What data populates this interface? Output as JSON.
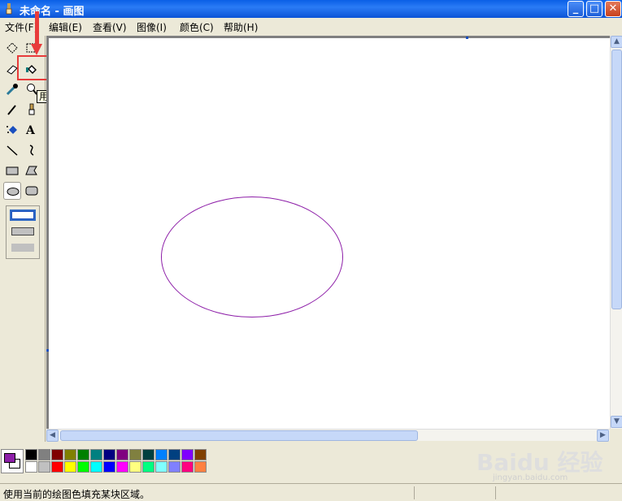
{
  "window": {
    "title": "未命名 - 画图"
  },
  "menu": [
    {
      "label": "文件(F)"
    },
    {
      "label": "编辑(E)"
    },
    {
      "label": "查看(V)"
    },
    {
      "label": "图像(I)"
    },
    {
      "label": "颜色(C)"
    },
    {
      "label": "帮助(H)"
    }
  ],
  "tooltip": {
    "text": "用颜色填充"
  },
  "colors": {
    "foreground": "#8d1ea8",
    "background": "#ffffff",
    "highlight": "#e83b3b"
  },
  "palette": {
    "row1": [
      "#000000",
      "#808080",
      "#800000",
      "#808000",
      "#008000",
      "#008080",
      "#000080",
      "#800080",
      "#808040",
      "#004040",
      "#0080ff",
      "#004080",
      "#8000ff",
      "#804000"
    ],
    "row2": [
      "#ffffff",
      "#c0c0c0",
      "#ff0000",
      "#ffff00",
      "#00ff00",
      "#00ffff",
      "#0000ff",
      "#ff00ff",
      "#ffff80",
      "#00ff80",
      "#80ffff",
      "#8080ff",
      "#ff0080",
      "#ff8040"
    ]
  },
  "statusbar": {
    "text": "使用当前的绘图色填充某块区域。"
  },
  "watermark": {
    "main": "Baidu 经验",
    "sub": "jingyan.baidu.com"
  }
}
